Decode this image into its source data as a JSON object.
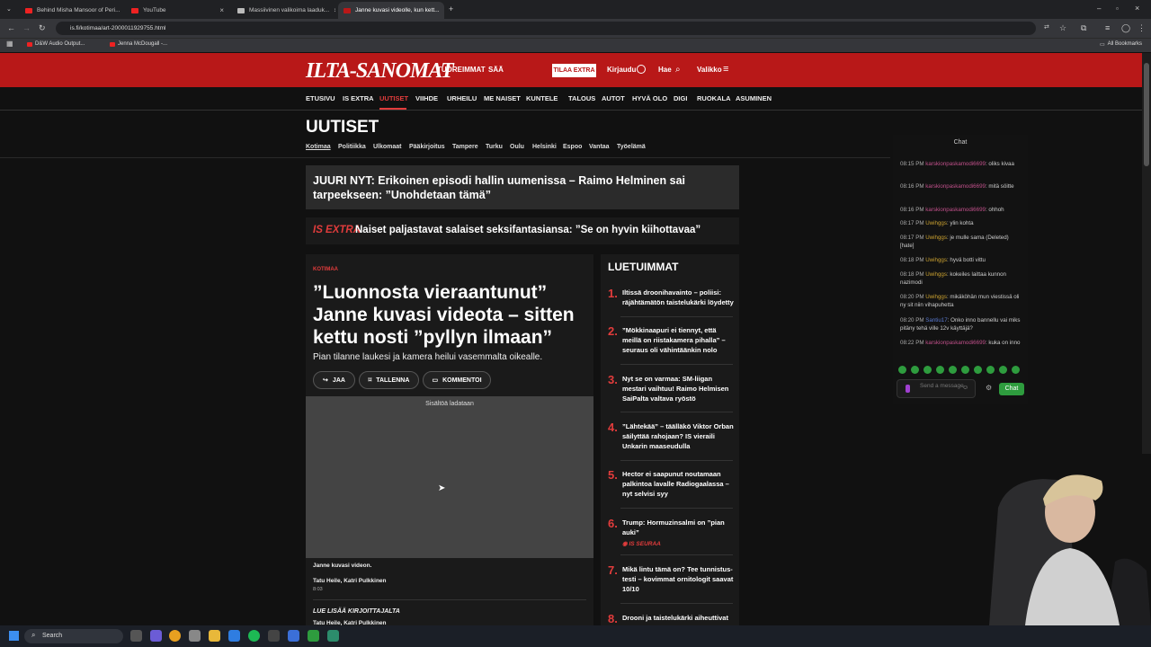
{
  "browser": {
    "tabs": [
      {
        "title": "Behind Misha Mansoor of Peri...",
        "active": false
      },
      {
        "title": "YouTube",
        "active": false
      },
      {
        "title": "Massiivinen valikoima laaduk...",
        "active": false
      },
      {
        "title": "Janne kuvasi videolle, kun kett...",
        "active": true
      }
    ],
    "url": "is.fi/kotimaa/art-2000011929755.html",
    "bookmarks": [
      "D&W Audio Output...",
      "Jenna McDougall -..."
    ],
    "all_bookmarks": "All Bookmarks"
  },
  "site": {
    "logo": "ILTA-SANOMAT",
    "top_links": [
      "TUOREIMMAT",
      "SÄÄ"
    ],
    "subscribe": "TILAA EXTRA",
    "login": "Kirjaudu",
    "search": "Hae",
    "menu": "Valikko",
    "nav": [
      "ETUSIVU",
      "IS EXTRA",
      "UUTISET",
      "VIIHDE",
      "URHEILU",
      "ME NAISET",
      "KUNTELE",
      "TALOUS",
      "AUTOT",
      "HYVÄ OLO",
      "DIGI",
      "RUOKALA",
      "ASUMINEN"
    ],
    "section": "UUTISET",
    "subnav": [
      "Kotimaa",
      "Politiikka",
      "Ulkomaat",
      "Pääkirjoitus",
      "Tampere",
      "Turku",
      "Oulu",
      "Helsinki",
      "Espoo",
      "Vantaa",
      "Työelämä"
    ]
  },
  "breaking": "JUURI NYT: Erikoinen episodi hallin uumenissa – Raimo Helminen sai tarpeekseen: ”Unohdetaan tämä”",
  "extra": {
    "tag": "IS EXTRA",
    "title": "Naiset paljastavat salaiset seksifantasiansa: ”Se on hyvin kiihottavaa”"
  },
  "article": {
    "category": "KOTIMAA",
    "title": "”Luonnosta vieraantunut” Janne kuvasi videota – sitten kettu nosti ”pyllyn ilmaan”",
    "lead": "Pian tilanne laukesi ja kamera heilui vasemmalta oikealle.",
    "actions": [
      "JAA",
      "TALLENNA",
      "KOMMENTOI"
    ],
    "video_loading": "Sisältöä ladataan",
    "caption": "Janne kuvasi videon.",
    "authors": "Tatu Heile, Katri Pulkkinen",
    "time": "8:03",
    "more_label": "LUE LISÄÄ KIRJOITTAJALTA",
    "more_authors": "Tatu Heile, Katri Pulkkinen"
  },
  "most_read": {
    "title": "LUETUIMMAT",
    "items": [
      {
        "n": "1.",
        "text": "Iltissä droonihavainto – poliisi: räjähtämätön taistelukärki löydetty"
      },
      {
        "n": "2.",
        "text": "”Mökkinaapuri ei tiennyt, että meillä on riistakamera pihalla” – seuraus oli vähintäänkin nolo"
      },
      {
        "n": "3.",
        "text": "Nyt se on varmaa: SM-liigan mestari vaihtuu! Raimo Helmisen SaiPalta valtava ryöstö"
      },
      {
        "n": "4.",
        "text": "”Lähtekää” – täälläkö Viktor Orban säilyttää rahojaan? IS vieraili Unkarin maaseudulla"
      },
      {
        "n": "5.",
        "text": "Hector ei saapunut noutamaan palkintoa lavalle Radiogaalassa – nyt selvisi syy"
      },
      {
        "n": "6.",
        "text": "Trump: Hormuzinsalmi on ”pian auki”",
        "tag": "IS SEURAA"
      },
      {
        "n": "7.",
        "text": "Mikä lintu tämä on? Tee tunnistus-testi – kovimmat ornitologit saavat 10/10"
      },
      {
        "n": "8.",
        "text": "Drooni ja taistelukärki aiheuttivat"
      }
    ]
  },
  "chat": {
    "title": "Chat",
    "messages": [
      {
        "time": "08:15 PM",
        "user": "karskionpaskamodi6699",
        "text": ": oliks kivaa"
      },
      {
        "time": "08:16 PM",
        "user": "karskionpaskamodi6699",
        "text": ": mitä söitte"
      },
      {
        "time": "08:16 PM",
        "user": "karskionpaskamodi6699",
        "text": ": ohhoh"
      },
      {
        "time": "08:17 PM",
        "user": "Uwihggs",
        "text": ": ylin kohta"
      },
      {
        "time": "08:17 PM",
        "user": "Uwihggs",
        "text": ": je mulle sama (Deleted) [hate]"
      },
      {
        "time": "08:18 PM",
        "user": "Uwihggs",
        "text": ": hyvä botti vittu"
      },
      {
        "time": "08:18 PM",
        "user": "Uwihggs",
        "text": ": kokeiles laittaa kunnon nazimodi"
      },
      {
        "time": "08:20 PM",
        "user": "Uwihggs",
        "text": ": mikäköhän mun viestissä oli ny sit niin vihapuhetta"
      },
      {
        "time": "08:20 PM",
        "user": "Santiu17",
        "text": ": Onko inno bannellu vai miks pitäny tehä ville 12v käyttäjä?"
      },
      {
        "time": "08:22 PM",
        "user": "karskionpaskamodi6699",
        "text": ": kuka on inno"
      }
    ],
    "placeholder": "Send a message",
    "button": "Chat"
  },
  "taskbar": {
    "search": "Search"
  }
}
